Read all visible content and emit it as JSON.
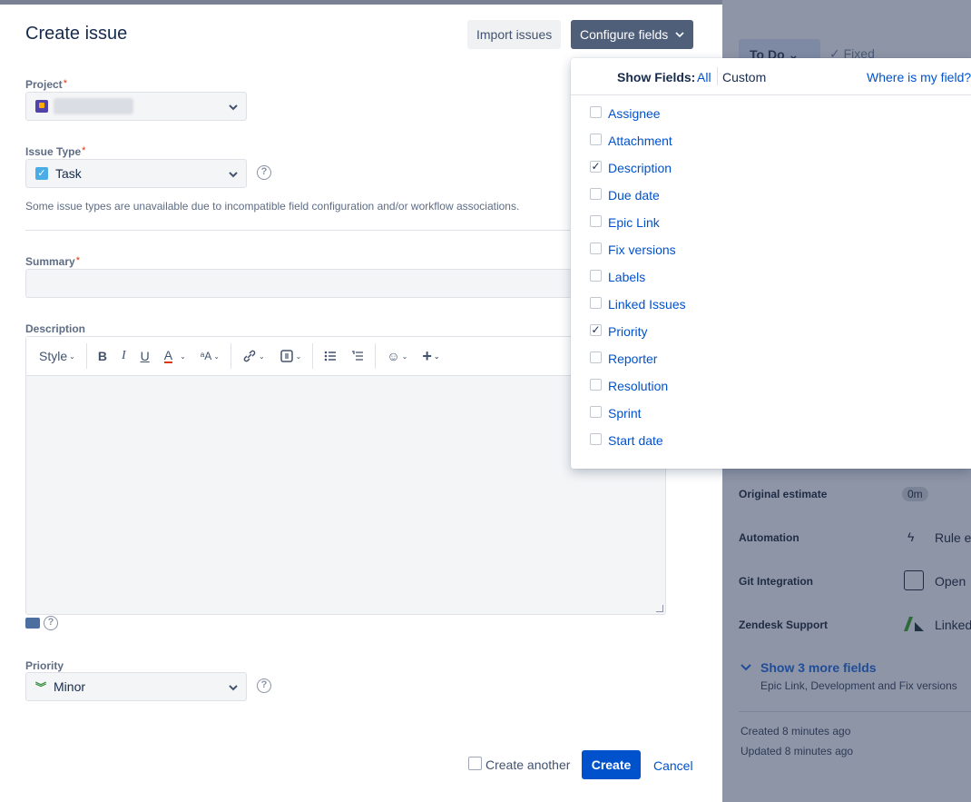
{
  "background": {
    "status_label": "To Do",
    "resolution": "Fixed",
    "rows": [
      {
        "label": "Original estimate",
        "value": "0m"
      },
      {
        "label": "Automation",
        "value": "Rule e"
      },
      {
        "label": "Git Integration",
        "value": "Open"
      },
      {
        "label": "Zendesk Support",
        "value": "Linked"
      }
    ],
    "show_more": "Show 3 more fields",
    "show_more_sub": "Epic Link, Development and Fix versions",
    "created": "Created 8 minutes ago",
    "updated": "Updated 8 minutes ago"
  },
  "modal": {
    "title": "Create issue",
    "import_label": "Import issues",
    "configure_label": "Configure fields",
    "project": {
      "label": "Project",
      "required": "*"
    },
    "issue_type": {
      "label": "Issue Type",
      "required": "*",
      "value": "Task",
      "hint": "Some issue types are unavailable due to incompatible field configuration and/or workflow associations."
    },
    "summary": {
      "label": "Summary",
      "required": "*",
      "value": ""
    },
    "description": {
      "label": "Description",
      "toolbar_style": "Style"
    },
    "priority": {
      "label": "Priority",
      "value": "Minor"
    },
    "footer": {
      "create_another": "Create another",
      "create": "Create",
      "cancel": "Cancel"
    }
  },
  "dropdown": {
    "show_fields": "Show Fields:",
    "all": "All",
    "custom": "Custom",
    "where": "Where is my field?",
    "items": [
      {
        "label": "Assignee",
        "checked": false
      },
      {
        "label": "Attachment",
        "checked": false
      },
      {
        "label": "Description",
        "checked": true
      },
      {
        "label": "Due date",
        "checked": false
      },
      {
        "label": "Epic Link",
        "checked": false
      },
      {
        "label": "Fix versions",
        "checked": false
      },
      {
        "label": "Labels",
        "checked": false
      },
      {
        "label": "Linked Issues",
        "checked": false
      },
      {
        "label": "Priority",
        "checked": true
      },
      {
        "label": "Reporter",
        "checked": false
      },
      {
        "label": "Resolution",
        "checked": false
      },
      {
        "label": "Sprint",
        "checked": false
      },
      {
        "label": "Start date",
        "checked": false
      }
    ]
  }
}
